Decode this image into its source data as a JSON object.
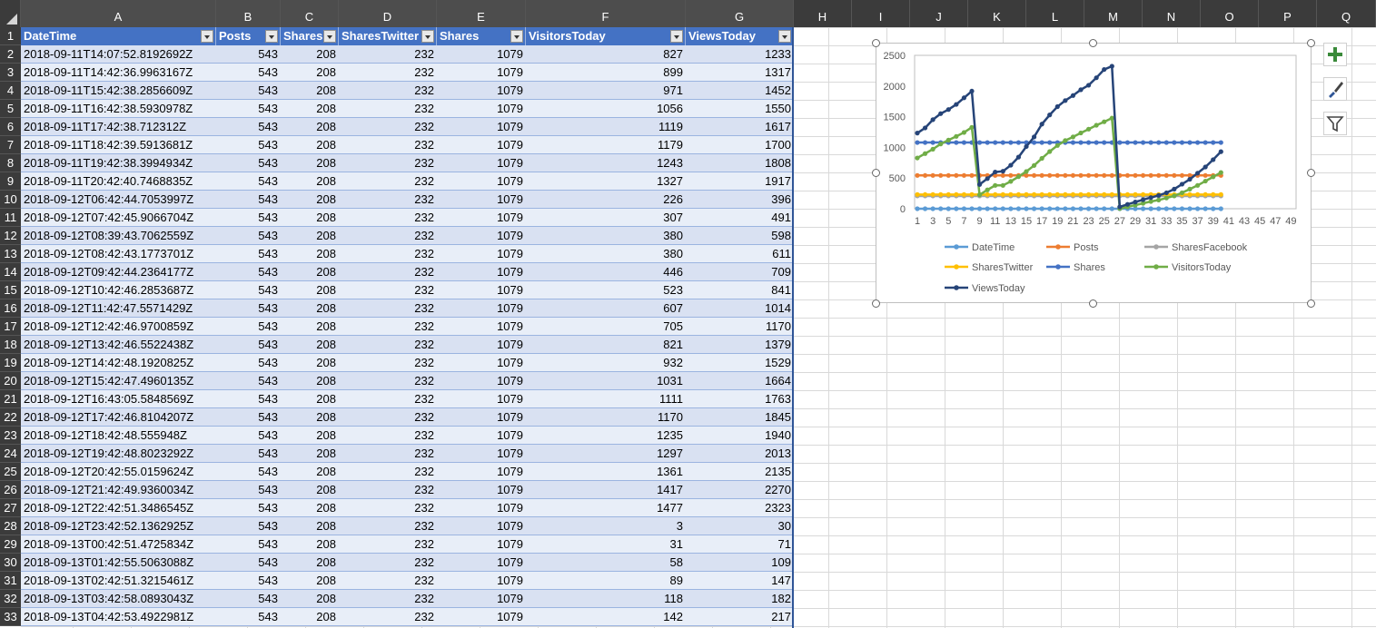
{
  "sheet": {
    "columns": [
      "A",
      "B",
      "C",
      "D",
      "E",
      "F",
      "G",
      "H",
      "I",
      "J",
      "K",
      "L",
      "M",
      "N",
      "O",
      "P",
      "Q"
    ],
    "row_numbers": [
      "1",
      "2",
      "3",
      "4",
      "5",
      "6",
      "7",
      "8",
      "9",
      "10",
      "11",
      "12",
      "13",
      "14",
      "15",
      "16",
      "17",
      "18",
      "19",
      "20",
      "21",
      "22",
      "23",
      "24",
      "25",
      "26",
      "27",
      "28",
      "29",
      "30",
      "31",
      "32",
      "33"
    ]
  },
  "table": {
    "headers": [
      "DateTime",
      "Posts",
      "SharesF",
      "SharesTwitter",
      "Shares",
      "VisitorsToday",
      "ViewsToday"
    ],
    "rows": [
      [
        "2018-09-11T14:07:52.8192692Z",
        "543",
        "208",
        "232",
        "1079",
        "827",
        "1233"
      ],
      [
        "2018-09-11T14:42:36.9963167Z",
        "543",
        "208",
        "232",
        "1079",
        "899",
        "1317"
      ],
      [
        "2018-09-11T15:42:38.2856609Z",
        "543",
        "208",
        "232",
        "1079",
        "971",
        "1452"
      ],
      [
        "2018-09-11T16:42:38.5930978Z",
        "543",
        "208",
        "232",
        "1079",
        "1056",
        "1550"
      ],
      [
        "2018-09-11T17:42:38.712312Z",
        "543",
        "208",
        "232",
        "1079",
        "1119",
        "1617"
      ],
      [
        "2018-09-11T18:42:39.5913681Z",
        "543",
        "208",
        "232",
        "1079",
        "1179",
        "1700"
      ],
      [
        "2018-09-11T19:42:38.3994934Z",
        "543",
        "208",
        "232",
        "1079",
        "1243",
        "1808"
      ],
      [
        "2018-09-11T20:42:40.7468835Z",
        "543",
        "208",
        "232",
        "1079",
        "1327",
        "1917"
      ],
      [
        "2018-09-12T06:42:44.7053997Z",
        "543",
        "208",
        "232",
        "1079",
        "226",
        "396"
      ],
      [
        "2018-09-12T07:42:45.9066704Z",
        "543",
        "208",
        "232",
        "1079",
        "307",
        "491"
      ],
      [
        "2018-09-12T08:39:43.7062559Z",
        "543",
        "208",
        "232",
        "1079",
        "380",
        "598"
      ],
      [
        "2018-09-12T08:42:43.1773701Z",
        "543",
        "208",
        "232",
        "1079",
        "380",
        "611"
      ],
      [
        "2018-09-12T09:42:44.2364177Z",
        "543",
        "208",
        "232",
        "1079",
        "446",
        "709"
      ],
      [
        "2018-09-12T10:42:46.2853687Z",
        "543",
        "208",
        "232",
        "1079",
        "523",
        "841"
      ],
      [
        "2018-09-12T11:42:47.5571429Z",
        "543",
        "208",
        "232",
        "1079",
        "607",
        "1014"
      ],
      [
        "2018-09-12T12:42:46.9700859Z",
        "543",
        "208",
        "232",
        "1079",
        "705",
        "1170"
      ],
      [
        "2018-09-12T13:42:46.5522438Z",
        "543",
        "208",
        "232",
        "1079",
        "821",
        "1379"
      ],
      [
        "2018-09-12T14:42:48.1920825Z",
        "543",
        "208",
        "232",
        "1079",
        "932",
        "1529"
      ],
      [
        "2018-09-12T15:42:47.4960135Z",
        "543",
        "208",
        "232",
        "1079",
        "1031",
        "1664"
      ],
      [
        "2018-09-12T16:43:05.5848569Z",
        "543",
        "208",
        "232",
        "1079",
        "1111",
        "1763"
      ],
      [
        "2018-09-12T17:42:46.8104207Z",
        "543",
        "208",
        "232",
        "1079",
        "1170",
        "1845"
      ],
      [
        "2018-09-12T18:42:48.555948Z",
        "543",
        "208",
        "232",
        "1079",
        "1235",
        "1940"
      ],
      [
        "2018-09-12T19:42:48.8023292Z",
        "543",
        "208",
        "232",
        "1079",
        "1297",
        "2013"
      ],
      [
        "2018-09-12T20:42:55.0159624Z",
        "543",
        "208",
        "232",
        "1079",
        "1361",
        "2135"
      ],
      [
        "2018-09-12T21:42:49.9360034Z",
        "543",
        "208",
        "232",
        "1079",
        "1417",
        "2270"
      ],
      [
        "2018-09-12T22:42:51.3486545Z",
        "543",
        "208",
        "232",
        "1079",
        "1477",
        "2323"
      ],
      [
        "2018-09-12T23:42:52.1362925Z",
        "543",
        "208",
        "232",
        "1079",
        "3",
        "30"
      ],
      [
        "2018-09-13T00:42:51.4725834Z",
        "543",
        "208",
        "232",
        "1079",
        "31",
        "71"
      ],
      [
        "2018-09-13T01:42:55.5063088Z",
        "543",
        "208",
        "232",
        "1079",
        "58",
        "109"
      ],
      [
        "2018-09-13T02:42:51.3215461Z",
        "543",
        "208",
        "232",
        "1079",
        "89",
        "147"
      ],
      [
        "2018-09-13T03:42:58.0893043Z",
        "543",
        "208",
        "232",
        "1079",
        "118",
        "182"
      ],
      [
        "2018-09-13T04:42:53.4922981Z",
        "543",
        "208",
        "232",
        "1079",
        "142",
        "217"
      ]
    ]
  },
  "chart_data": {
    "type": "line",
    "yticks": [
      "0",
      "500",
      "1000",
      "1500",
      "2000",
      "2500"
    ],
    "ylim": [
      0,
      2500
    ],
    "xticks": [
      "1",
      "3",
      "5",
      "7",
      "9",
      "11",
      "13",
      "15",
      "17",
      "19",
      "21",
      "23",
      "25",
      "27",
      "29",
      "31",
      "33",
      "35",
      "37",
      "39",
      "41",
      "43",
      "45",
      "47",
      "49"
    ],
    "xlim": [
      1,
      50
    ],
    "legend_position": "bottom",
    "series": [
      {
        "name": "DateTime",
        "color": "#5b9bd5",
        "values": [
          0,
          0,
          0,
          0,
          0,
          0,
          0,
          0,
          0,
          0,
          0,
          0,
          0,
          0,
          0,
          0,
          0,
          0,
          0,
          0,
          0,
          0,
          0,
          0,
          0,
          0,
          0,
          0,
          0,
          0,
          0,
          0,
          0,
          0,
          0,
          0,
          0,
          0,
          0,
          0
        ]
      },
      {
        "name": "Posts",
        "color": "#ed7d31",
        "values": [
          543,
          543,
          543,
          543,
          543,
          543,
          543,
          543,
          543,
          543,
          543,
          543,
          543,
          543,
          543,
          543,
          543,
          543,
          543,
          543,
          543,
          543,
          543,
          543,
          543,
          543,
          543,
          543,
          543,
          543,
          543,
          543,
          543,
          543,
          543,
          543,
          543,
          543,
          543,
          543
        ]
      },
      {
        "name": "SharesFacebook",
        "color": "#a5a5a5",
        "values": [
          208,
          208,
          208,
          208,
          208,
          208,
          208,
          208,
          208,
          208,
          208,
          208,
          208,
          208,
          208,
          208,
          208,
          208,
          208,
          208,
          208,
          208,
          208,
          208,
          208,
          208,
          208,
          208,
          208,
          208,
          208,
          208,
          208,
          208,
          208,
          208,
          208,
          208,
          208,
          208
        ]
      },
      {
        "name": "SharesTwitter",
        "color": "#ffc000",
        "values": [
          232,
          232,
          232,
          232,
          232,
          232,
          232,
          232,
          232,
          232,
          232,
          232,
          232,
          232,
          232,
          232,
          232,
          232,
          232,
          232,
          232,
          232,
          232,
          232,
          232,
          232,
          232,
          232,
          232,
          232,
          232,
          232,
          232,
          232,
          232,
          232,
          232,
          232,
          232,
          232
        ]
      },
      {
        "name": "Shares",
        "color": "#4472c4",
        "values": [
          1079,
          1079,
          1079,
          1079,
          1079,
          1079,
          1079,
          1079,
          1079,
          1079,
          1079,
          1079,
          1079,
          1079,
          1079,
          1079,
          1079,
          1079,
          1079,
          1079,
          1079,
          1079,
          1079,
          1079,
          1079,
          1079,
          1079,
          1079,
          1079,
          1079,
          1079,
          1079,
          1079,
          1079,
          1079,
          1079,
          1079,
          1079,
          1079,
          1079
        ]
      },
      {
        "name": "VisitorsToday",
        "color": "#70ad47",
        "values": [
          827,
          899,
          971,
          1056,
          1119,
          1179,
          1243,
          1327,
          226,
          307,
          380,
          380,
          446,
          523,
          607,
          705,
          821,
          932,
          1031,
          1111,
          1170,
          1235,
          1297,
          1361,
          1417,
          1477,
          3,
          31,
          58,
          89,
          118,
          142,
          175,
          210,
          260,
          320,
          380,
          450,
          520,
          590
        ]
      },
      {
        "name": "ViewsToday",
        "color": "#264478",
        "values": [
          1233,
          1317,
          1452,
          1550,
          1617,
          1700,
          1808,
          1917,
          396,
          491,
          598,
          611,
          709,
          841,
          1014,
          1170,
          1379,
          1529,
          1664,
          1763,
          1845,
          1940,
          2013,
          2135,
          2270,
          2323,
          30,
          71,
          109,
          147,
          182,
          217,
          260,
          320,
          400,
          480,
          580,
          680,
          800,
          930
        ]
      }
    ]
  }
}
